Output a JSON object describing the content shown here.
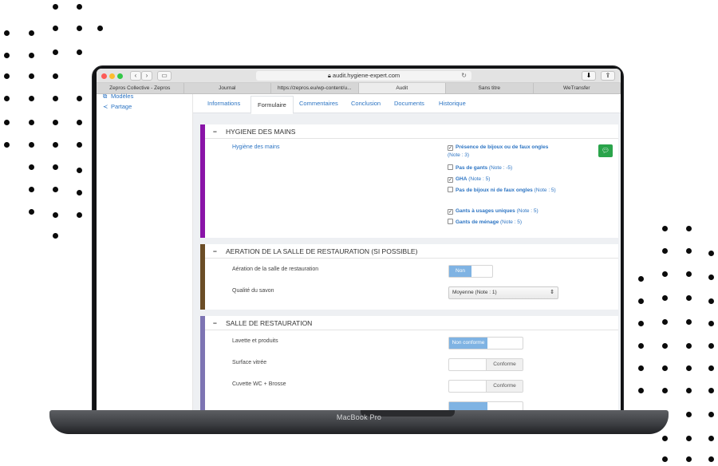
{
  "browser": {
    "url": "audit.hygiene-expert.com",
    "tabs": [
      "Zepros Collective - Zepros",
      "Journal",
      "https://zepros.eu/wp-content/u...",
      "Audit",
      "Sans titre",
      "WeTransfer"
    ]
  },
  "laptop": {
    "brand": "MacBook Pro"
  },
  "sidebar": {
    "items": [
      {
        "label": "Modèles"
      },
      {
        "label": "Partage"
      }
    ]
  },
  "subtabs": [
    "Informations",
    "Formulaire",
    "Commentaires",
    "Conclusion",
    "Documents",
    "Historique"
  ],
  "sections": {
    "hygiene": {
      "title": "HYGIENE DES MAINS",
      "question": "Hygiène des mains",
      "options": [
        {
          "name": "Présence de bijoux ou de faux ongles",
          "note": "(Note : 3)",
          "checked": true
        },
        {
          "name": "Pas de gants",
          "note": "(Note : -5)",
          "checked": false
        },
        {
          "name": "GHA",
          "note": "(Note : 5)",
          "checked": true
        },
        {
          "name": "Pas de bijoux ni de faux ongles",
          "note": "(Note : 5)",
          "checked": false
        },
        {
          "name": "Gants à usages uniques",
          "note": "(Note : 5)",
          "checked": true
        },
        {
          "name": "Gants de ménage",
          "note": "(Note : 5)",
          "checked": false
        }
      ],
      "color": "#8a14a8"
    },
    "aeration": {
      "title": "AERATION DE LA SALLE DE RESTAURATION (SI POSSIBLE)",
      "q1": "Aération de la salle de restauration",
      "q1_value": "Non",
      "q2": "Qualité du savon",
      "q2_value": "Moyenne (Note : 1)",
      "color": "#6b4d26"
    },
    "salle": {
      "title": "SALLE DE RESTAURATION",
      "rows": [
        {
          "label": "Lavette et produits",
          "value": "Non conforme"
        },
        {
          "label": "Surface vitrée",
          "value": "Conforme"
        },
        {
          "label": "Cuvette WC + Brosse",
          "value": "Conforme"
        }
      ],
      "color": "#7d74b3"
    }
  },
  "colors": {
    "link": "#2c74c3",
    "accent_toggle": "#7fb3e3",
    "comment_button": "#2aa44b"
  },
  "icons": [
    "chevron-left-icon",
    "chevron-right-icon",
    "sidebar-icon",
    "lock-icon",
    "reload-icon",
    "download-icon",
    "share-icon",
    "templates-icon",
    "share-nodes-icon",
    "comment-icon",
    "checkbox-icon"
  ]
}
